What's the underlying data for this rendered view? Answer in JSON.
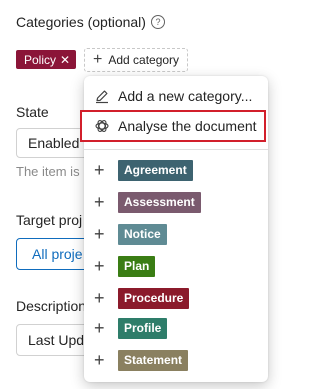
{
  "categories": {
    "label": "Categories (optional)",
    "help_icon": "help-circle-icon",
    "selected": [
      {
        "label": "Policy",
        "color": "#8b1538"
      }
    ],
    "add_label": "Add category"
  },
  "form": {
    "state_label": "State",
    "state_value": "Enabled",
    "state_helper": "The item is",
    "target_label": "Target proj",
    "target_value": "All proje",
    "description_label": "Description",
    "description_value": "Last Upd"
  },
  "menu": {
    "new_category": "Add a new category...",
    "analyse": "Analyse the document",
    "options": [
      {
        "label": "Agreement",
        "color": "#3d6370"
      },
      {
        "label": "Assessment",
        "color": "#7a5a6e"
      },
      {
        "label": "Notice",
        "color": "#5f8b94"
      },
      {
        "label": "Plan",
        "color": "#3a7d14"
      },
      {
        "label": "Procedure",
        "color": "#8b1a2b"
      },
      {
        "label": "Profile",
        "color": "#2e7d6a"
      },
      {
        "label": "Statement",
        "color": "#8a8060"
      }
    ]
  }
}
